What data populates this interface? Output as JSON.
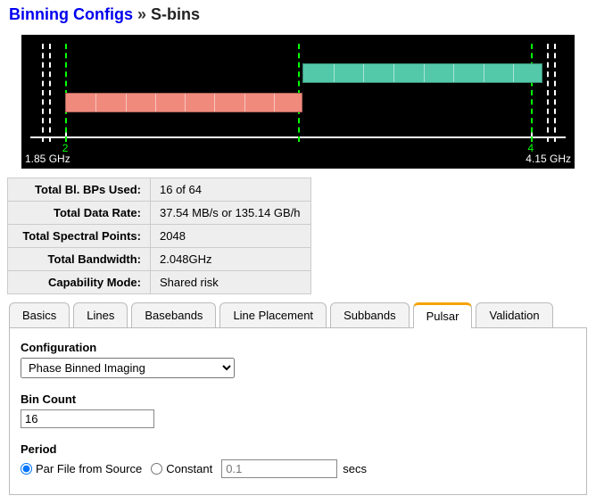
{
  "breadcrumb": {
    "root": "Binning Configs",
    "sep": "»",
    "current": "S-bins"
  },
  "chart_data": {
    "type": "bar",
    "x_axis": {
      "min": 1.85,
      "max": 4.15,
      "unit": "GHz",
      "ticks": [
        2,
        4
      ]
    },
    "labels": {
      "left": "1.85 GHz",
      "right": "4.15 GHz",
      "tick_2": "2",
      "tick_4": "4"
    },
    "guides_green": [
      2.0,
      3.0,
      4.0
    ],
    "guides_white": [
      1.9,
      1.93,
      4.07,
      4.1
    ],
    "bands": [
      {
        "color": "red",
        "start": 2.0,
        "end": 3.02,
        "segments": 8
      },
      {
        "color": "green",
        "start": 3.02,
        "end": 4.05,
        "segments": 8
      }
    ]
  },
  "summary": {
    "rows": [
      {
        "label": "Total Bl. BPs Used:",
        "value": "16 of 64"
      },
      {
        "label": "Total Data Rate:",
        "value": "37.54 MB/s or 135.14 GB/h"
      },
      {
        "label": "Total Spectral Points:",
        "value": "2048"
      },
      {
        "label": "Total Bandwidth:",
        "value": "2.048GHz"
      },
      {
        "label": "Capability Mode:",
        "value": "Shared risk"
      }
    ]
  },
  "tabs": {
    "items": [
      "Basics",
      "Lines",
      "Basebands",
      "Line Placement",
      "Subbands",
      "Pulsar",
      "Validation"
    ],
    "active": "Pulsar"
  },
  "form": {
    "configuration": {
      "label": "Configuration",
      "value": "Phase Binned Imaging",
      "options": [
        "Phase Binned Imaging"
      ]
    },
    "bin_count": {
      "label": "Bin Count",
      "value": "16"
    },
    "period": {
      "label": "Period",
      "par_label": "Par File from Source",
      "const_label": "Constant",
      "const_placeholder": "0.1",
      "unit": "secs",
      "selected": "par"
    }
  }
}
